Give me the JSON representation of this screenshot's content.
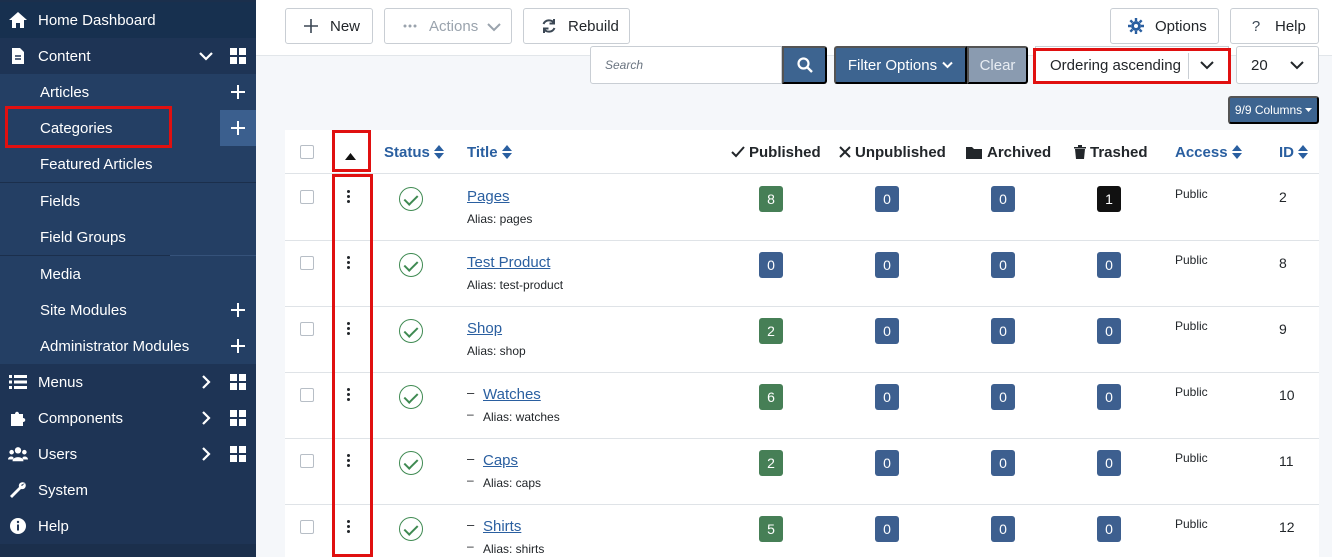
{
  "sidebar": {
    "home": "Home Dashboard",
    "content": "Content",
    "items": [
      {
        "label": "Articles",
        "plus": true
      },
      {
        "label": "Categories",
        "plus": true,
        "active": true
      },
      {
        "label": "Featured Articles",
        "plus": false
      },
      {
        "label": "Fields",
        "plus": false
      },
      {
        "label": "Field Groups",
        "plus": false
      },
      {
        "label": "Media",
        "plus": false
      },
      {
        "label": "Site Modules",
        "plus": true
      },
      {
        "label": "Administrator Modules",
        "plus": true
      }
    ],
    "menus": "Menus",
    "components": "Components",
    "users": "Users",
    "system": "System",
    "help": "Help"
  },
  "toolbar": {
    "new_label": "New",
    "actions_label": "Actions",
    "rebuild_label": "Rebuild",
    "options_label": "Options",
    "help_label": "Help"
  },
  "filters": {
    "search_placeholder": "Search",
    "filter_options_label": "Filter Options",
    "clear_label": "Clear",
    "ordering_value": "Ordering ascending",
    "limit_value": "20",
    "columns_label": "9/9 Columns"
  },
  "table": {
    "headers": {
      "status": "Status",
      "title": "Title",
      "published": "Published",
      "unpublished": "Unpublished",
      "archived": "Archived",
      "trashed": "Trashed",
      "access": "Access",
      "id": "ID"
    },
    "rows": [
      {
        "title": "Pages",
        "alias": "Alias: pages",
        "child": false,
        "published": "8",
        "unpublished": "0",
        "archived": "0",
        "trashed": "1",
        "access": "Public",
        "id": "2"
      },
      {
        "title": "Test Product",
        "alias": "Alias: test-product",
        "child": false,
        "published": "0",
        "unpublished": "0",
        "archived": "0",
        "trashed": "0",
        "access": "Public",
        "id": "8"
      },
      {
        "title": "Shop",
        "alias": "Alias: shop",
        "child": false,
        "published": "2",
        "unpublished": "0",
        "archived": "0",
        "trashed": "0",
        "access": "Public",
        "id": "9"
      },
      {
        "title": "Watches",
        "alias": "Alias: watches",
        "child": true,
        "published": "6",
        "unpublished": "0",
        "archived": "0",
        "trashed": "0",
        "access": "Public",
        "id": "10"
      },
      {
        "title": "Caps",
        "alias": "Alias: caps",
        "child": true,
        "published": "2",
        "unpublished": "0",
        "archived": "0",
        "trashed": "0",
        "access": "Public",
        "id": "11"
      },
      {
        "title": "Shirts",
        "alias": "Alias: shirts",
        "child": true,
        "published": "5",
        "unpublished": "0",
        "archived": "0",
        "trashed": "0",
        "access": "Public",
        "id": "12"
      }
    ],
    "child_dash": "–"
  },
  "colors": {
    "sidebar_bg": "#1b2f4c",
    "accent_blue": "#3d6490",
    "published_green": "#467f56",
    "count_blue": "#3d5f8f",
    "trashed_black": "#111111",
    "highlight_red": "#e01010"
  }
}
